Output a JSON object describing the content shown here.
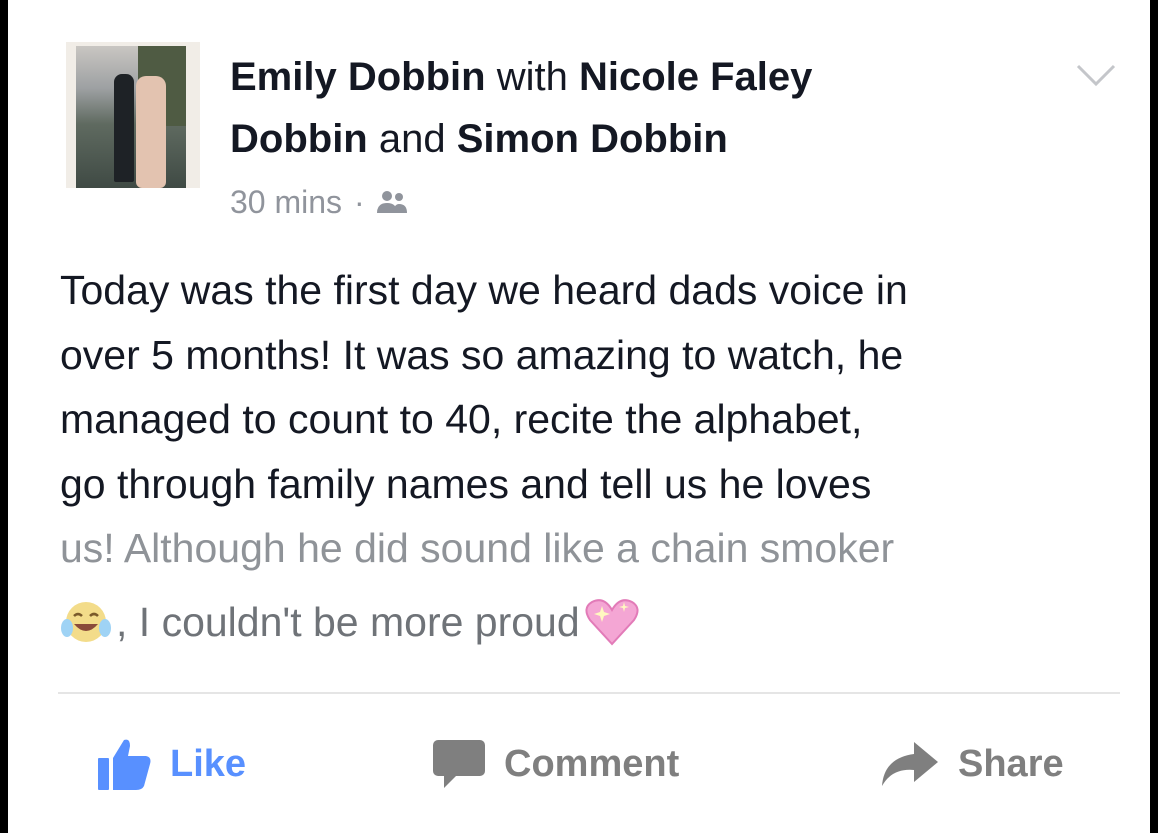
{
  "post": {
    "author": "Emily Dobbin",
    "with_word": "with",
    "tagged_first": "Nicole Faley",
    "tagged_first_cont": "Dobbin",
    "and_word": "and",
    "tagged_second": "Simon Dobbin",
    "timestamp": "30 mins",
    "separator": "·",
    "audience_icon": "friends-icon",
    "text_lines": [
      "Today was the first day we heard dads voice in",
      "over 5 months! It was so amazing to watch, he",
      "managed to count to 40, recite the alphabet,",
      "go through family names and tell us he loves",
      "us! Although he did sound like a chain smoker"
    ],
    "text_tail": ", I couldn't be more proud",
    "emojis": [
      "face-with-tears-of-joy-emoji",
      "sparkling-heart-emoji"
    ]
  },
  "actions": {
    "like": "Like",
    "comment": "Comment",
    "share": "Share"
  },
  "colors": {
    "like_blue": "#5890ff",
    "action_gray": "#7f7f7f",
    "name_text": "#141823",
    "meta_gray": "#90949c"
  }
}
